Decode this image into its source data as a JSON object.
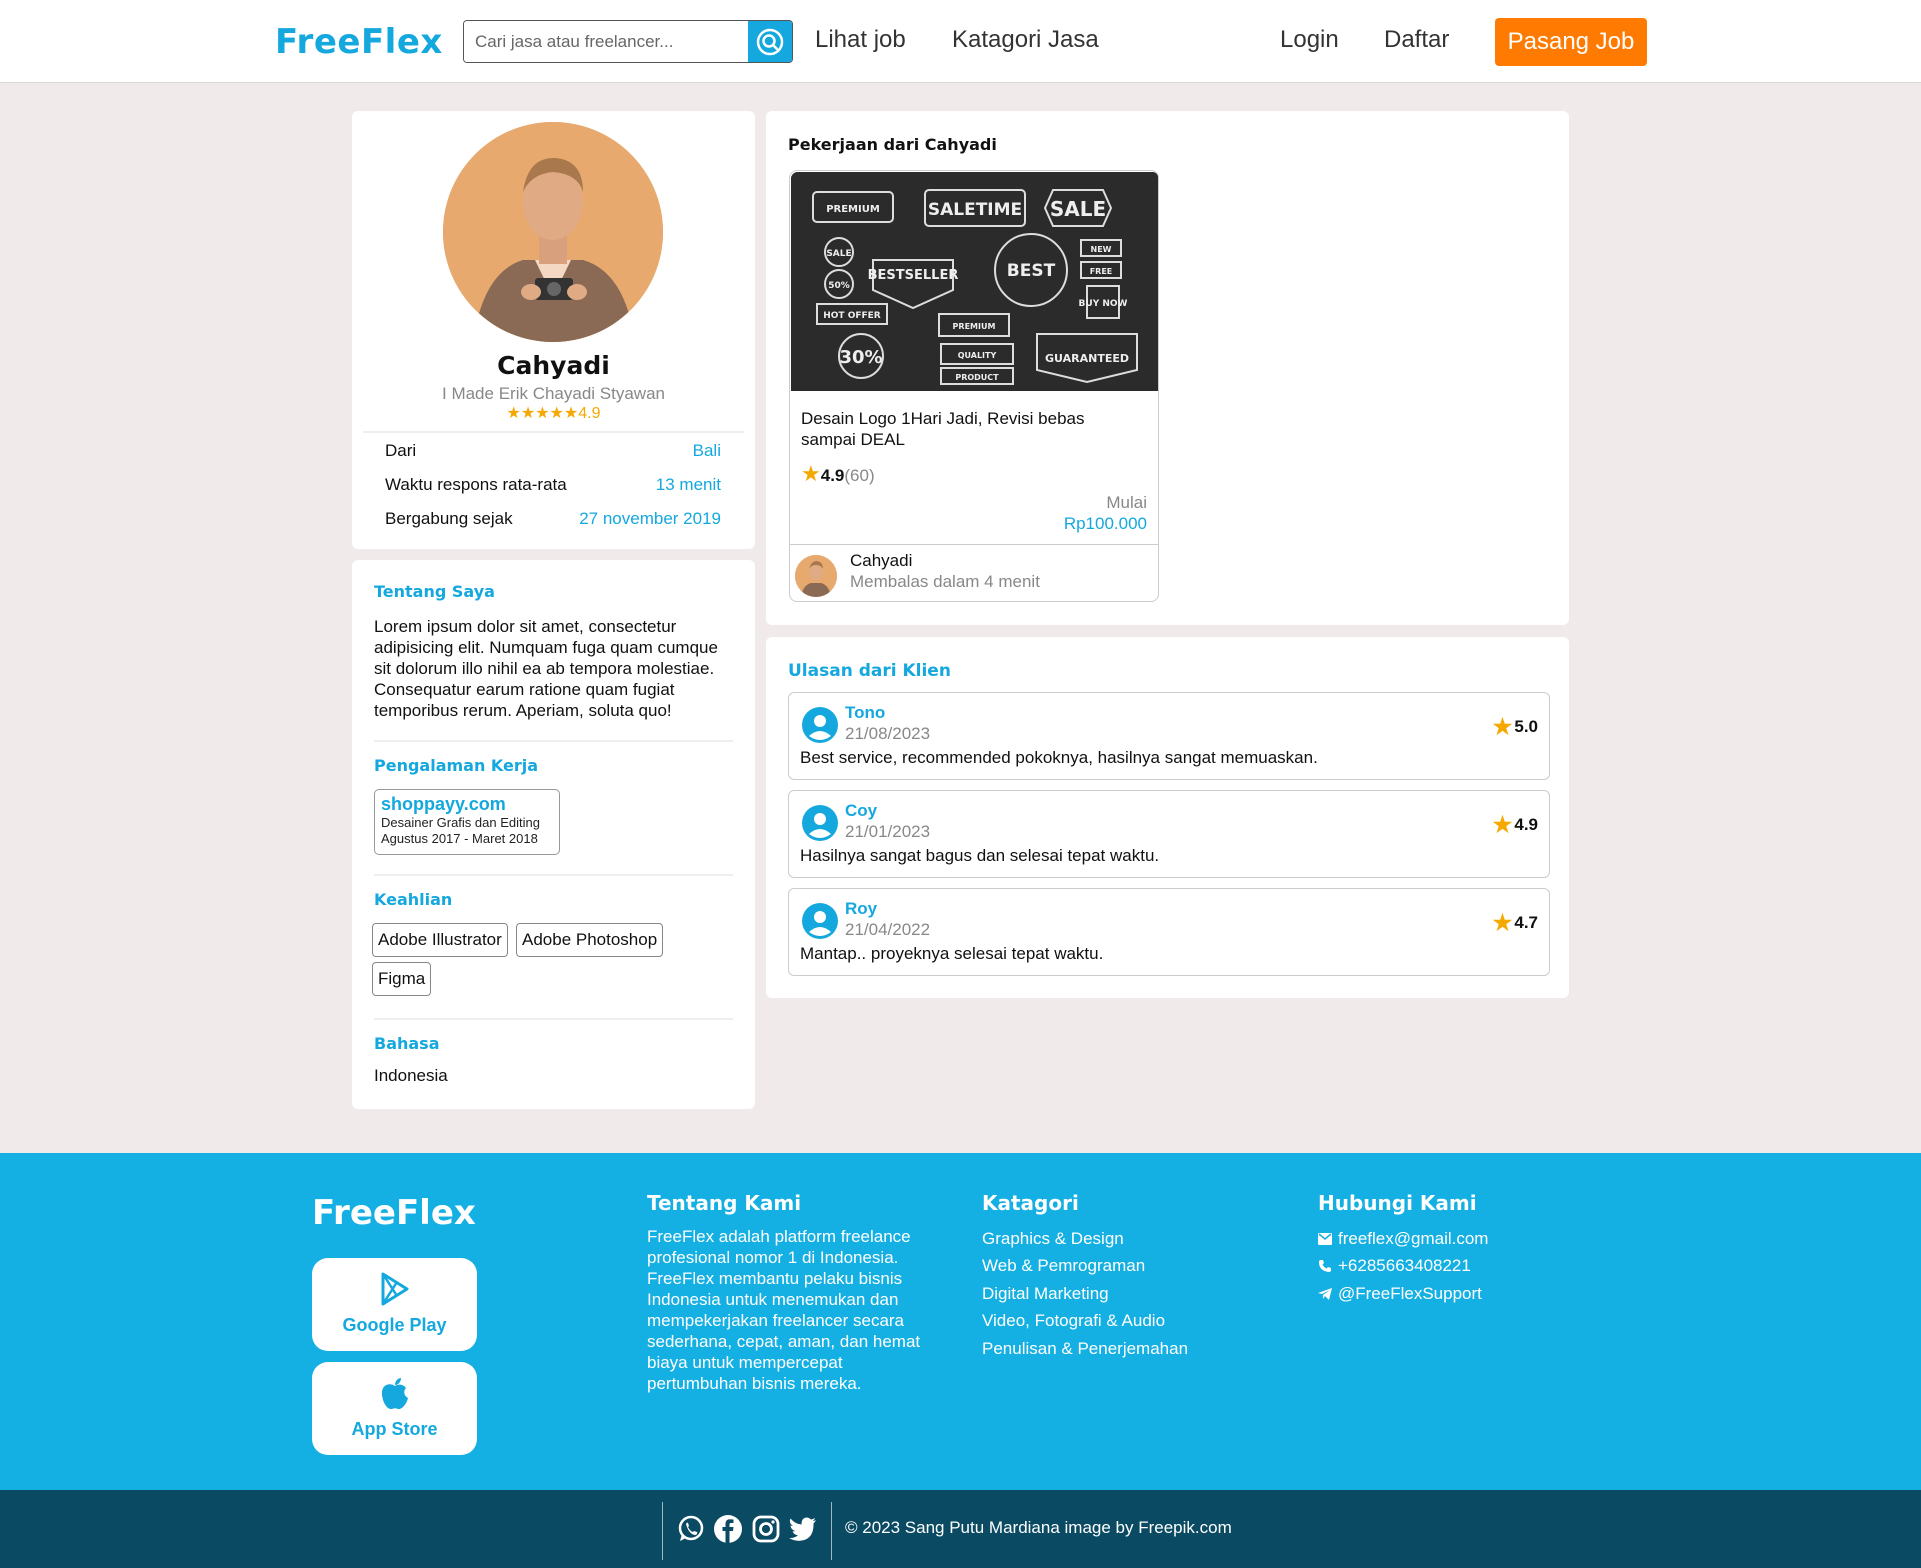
{
  "header": {
    "logo": "FreeFlex",
    "search_placeholder": "Cari jasa atau freelancer...",
    "nav": [
      "Lihat job",
      "Katagori Jasa"
    ],
    "login": "Login",
    "register": "Daftar",
    "post_job": "Pasang Job"
  },
  "profile": {
    "name": "Cahyadi",
    "full_name": "I Made Erik Chayadi Styawan",
    "rating_stars": "★★★★★",
    "rating": "4.9",
    "info": [
      {
        "label": "Dari",
        "value": "Bali"
      },
      {
        "label": "Waktu respons rata-rata",
        "value": "13 menit"
      },
      {
        "label": "Bergabung sejak",
        "value": "27 november 2019"
      }
    ]
  },
  "about": {
    "title": "Tentang Saya",
    "text": "Lorem ipsum dolor sit amet, consectetur adipisicing elit. Numquam fuga quam cumque sit dolorum illo nihil ea ab tempora molestiae. Consequatur earum ratione quam fugiat temporibus rerum. Aperiam, soluta quo!",
    "experience_title": "Pengalaman Kerja",
    "experience": {
      "company": "shoppayy.com",
      "role": "Desainer Grafis dan Editing",
      "period": "Agustus 2017 - Maret 2018"
    },
    "skills_title": "Keahlian",
    "skills": [
      "Adobe Illustrator",
      "Adobe Photoshop",
      "Figma"
    ],
    "language_title": "Bahasa",
    "language": "Indonesia"
  },
  "jobs": {
    "title": "Pekerjaan dari Cahyadi",
    "items": [
      {
        "title": "Desain Logo 1Hari Jadi, Revisi bebas sampai DEAL",
        "rating": "4.9",
        "count": "(60)",
        "price_label": "Mulai",
        "price": "Rp100.000",
        "seller": "Cahyadi",
        "reply": "Membalas dalam 4 menit",
        "image_badges": [
          "PREMIUM",
          "SALETIME",
          "SALE",
          "SALE",
          "BESTSELLER",
          "BEST",
          "NEW",
          "FREE",
          "50%",
          "HOT OFFER",
          "PREMIUM",
          "BUY NOW",
          "30%",
          "QUALITY",
          "GUARANTEED",
          "PRODUCT"
        ]
      }
    ]
  },
  "reviews": {
    "title": "Ulasan dari Klien",
    "items": [
      {
        "name": "Tono",
        "date": "21/08/2023",
        "text": "Best service, recommended pokoknya, hasilnya sangat memuaskan.",
        "score": "5.0"
      },
      {
        "name": "Coy",
        "date": "21/01/2023",
        "text": "Hasilnya sangat bagus dan selesai tepat waktu.",
        "score": "4.9"
      },
      {
        "name": "Roy",
        "date": "21/04/2022",
        "text": "Mantap.. proyeknya selesai tepat waktu.",
        "score": "4.7"
      }
    ]
  },
  "footer": {
    "logo": "FreeFlex",
    "google_play": "Google Play",
    "app_store": "App Store",
    "about_title": "Tentang Kami",
    "about_text": "FreeFlex adalah platform freelance profesional nomor 1 di Indonesia. FreeFlex membantu pelaku bisnis Indonesia untuk menemukan dan mempekerjakan freelancer secara sederhana, cepat, aman, dan hemat biaya untuk mempercepat pertumbuhan bisnis mereka.",
    "category_title": "Katagori",
    "categories": [
      "Graphics & Design",
      "Web & Pemrograman",
      "Digital Marketing",
      "Video, Fotografi & Audio",
      "Penulisan & Penerjemahan"
    ],
    "contact_title": "Hubungi Kami",
    "contacts": [
      {
        "icon": "mail-icon",
        "text": "freeflex@gmail.com"
      },
      {
        "icon": "phone-icon",
        "text": "+6285663408221"
      },
      {
        "icon": "telegram-icon",
        "text": "@FreeFlexSupport"
      }
    ],
    "copyright": "© 2023 Sang Putu Mardiana image by Freepik.com",
    "social_icons": [
      "whatsapp-icon",
      "facebook-icon",
      "instagram-icon",
      "twitter-icon"
    ]
  },
  "colors": {
    "accent": "#14a8de",
    "orange": "#ff7a00",
    "star": "#f5a800",
    "footer": "#14b0e3",
    "bottom": "#0a4a63"
  }
}
